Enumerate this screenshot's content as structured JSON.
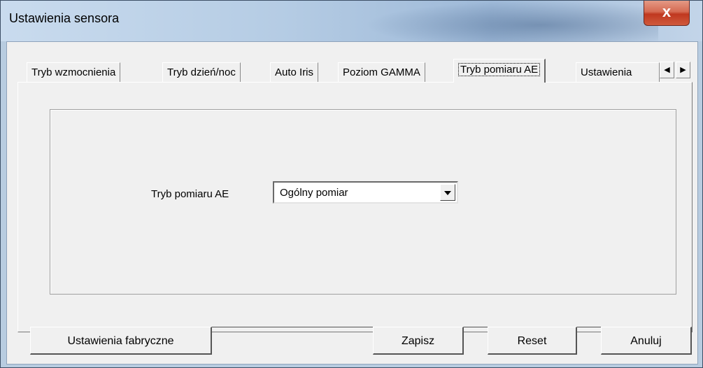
{
  "window": {
    "title": "Ustawienia sensora",
    "close_glyph": "x"
  },
  "tabs": [
    {
      "label": "Tryb wzmocnienia"
    },
    {
      "label": "Tryb dzień/noc"
    },
    {
      "label": "Auto Iris"
    },
    {
      "label": "Poziom GAMMA"
    },
    {
      "label": "Tryb pomiaru AE",
      "active": true
    },
    {
      "label": "Ustawienia"
    }
  ],
  "tab_scroll": {
    "left_glyph": "◀",
    "right_glyph": "▶"
  },
  "form": {
    "ae_label": "Tryb pomiaru AE",
    "ae_value": "Ogólny pomiar"
  },
  "buttons": {
    "factory": "Ustawienia fabryczne",
    "save": "Zapisz",
    "reset": "Reset",
    "cancel": "Anuluj"
  }
}
